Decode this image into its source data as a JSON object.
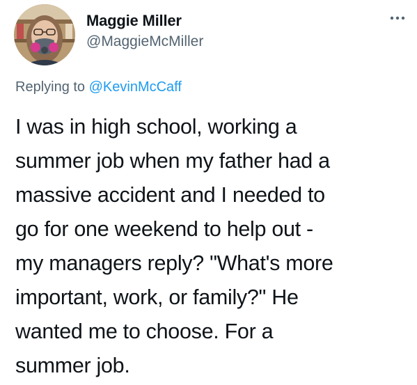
{
  "tweet": {
    "author": {
      "display_name": "Maggie Miller",
      "handle": "@MaggieMcMiller"
    },
    "more_icon": "more-horizontal-icon",
    "reply_prefix": "Replying to",
    "reply_to": "@KevinMcCaff",
    "text_lines": [
      "I was in high school, working a",
      "summer job when my father had a",
      "massive accident and I needed to",
      "go for one weekend to help out -",
      "my managers reply? \"What's more",
      "important, work, or family?\" He",
      "wanted me to choose. For a",
      "summer job."
    ]
  },
  "colors": {
    "text": "#0f1419",
    "secondary": "#536471",
    "link": "#1d9bf0"
  }
}
